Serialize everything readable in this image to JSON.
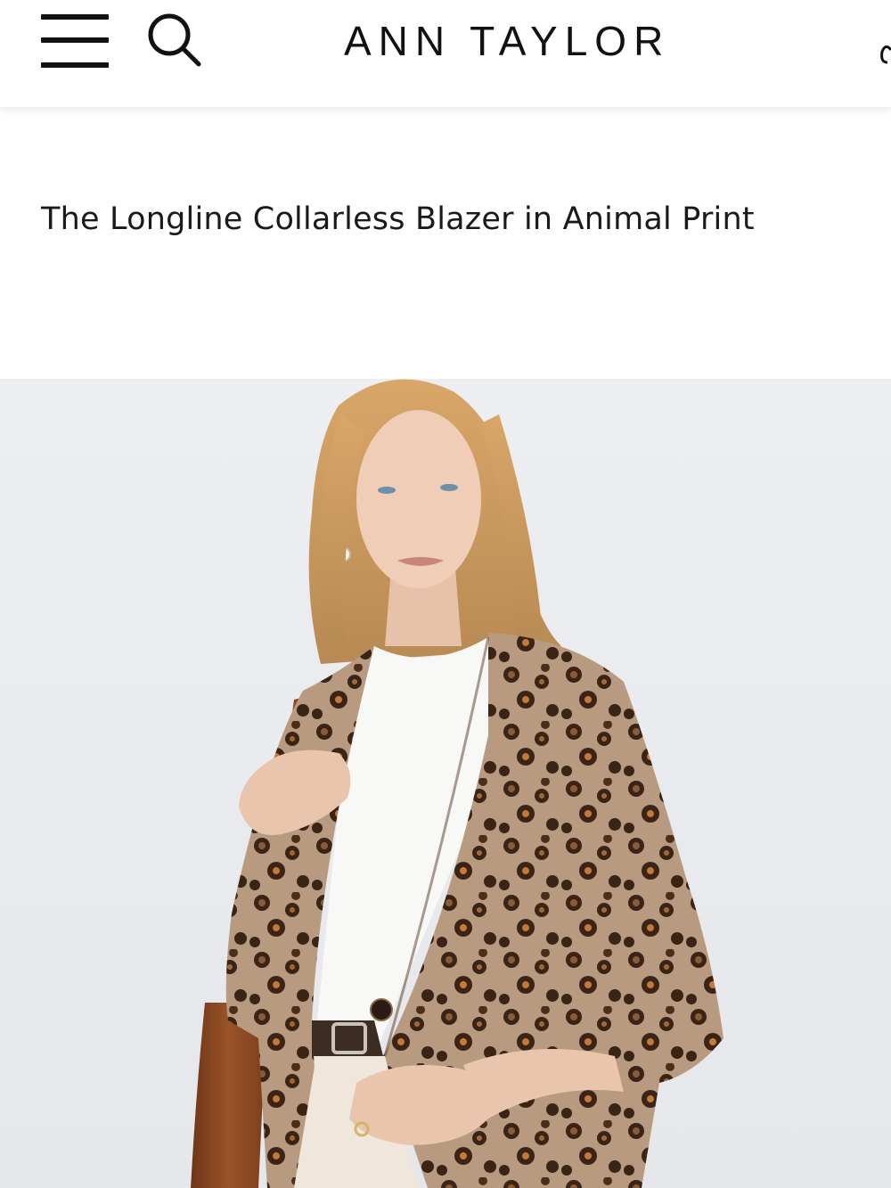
{
  "header": {
    "brand": "ANN TAYLOR",
    "menu_icon": "hamburger-menu-icon",
    "search_icon": "search-icon",
    "bag_icon": "shopping-bag-icon"
  },
  "product": {
    "title": "The Longline Collarless Blazer in Animal Print",
    "image": {
      "alt": "Model wearing a longline collarless blazer in leopard animal print over a white top, carrying a brown leather shoulder bag"
    }
  },
  "colors": {
    "background": "#ffffff",
    "text": "#1a1a1a",
    "photo_background": "#ecedef",
    "leopard_base": "#b89a80",
    "leopard_spot": "#3a2416",
    "bag_brown": "#8a4a22"
  }
}
